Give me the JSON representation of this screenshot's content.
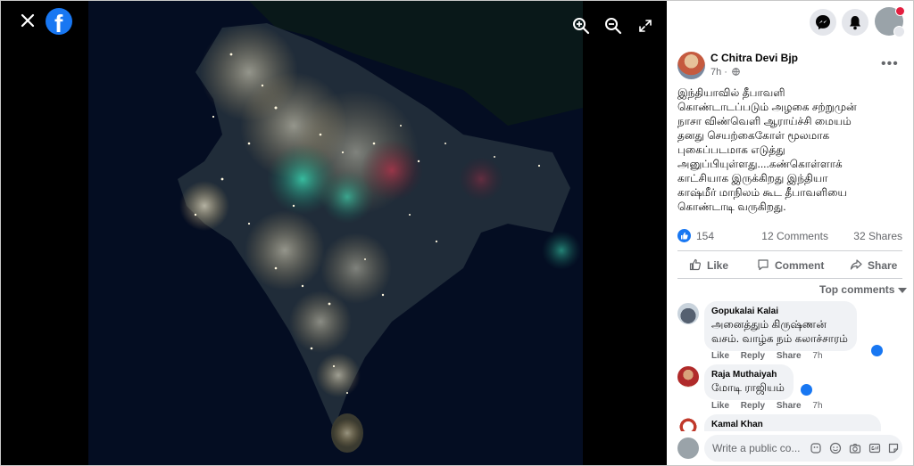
{
  "viewer": {
    "close_icon": "close-icon",
    "logo_icon": "facebook-logo-icon",
    "logo_letter": "f",
    "zoom_in_icon": "zoom-in-icon",
    "zoom_out_icon": "zoom-out-icon",
    "fullscreen_icon": "fullscreen-icon"
  },
  "topbar": {
    "messenger_icon": "messenger-icon",
    "notifications_icon": "bell-icon",
    "profile_icon": "account-avatar"
  },
  "post": {
    "author": "C Chitra Devi Bjp",
    "time": "7h ·",
    "privacy_icon": "globe-icon",
    "more_label": "•••",
    "text_lines": [
      "இந்தியாவில் தீபாவளி",
      "கொண்டாடப்படும் அழகை சற்றுமுன்",
      "நாசா விண்வெளி ஆராய்ச்சி மையம்",
      "தனது செயற்கைகோள் மூலமாக",
      "புகைப்படமாக எடுத்து",
      "அனுப்பியுள்ளது....கண்கொள்ளாக்",
      "காட்சியாக இருக்கிறது இந்தியா",
      "காஷ்மீர் மாநிலம் கூட தீபாவளியை",
      "கொண்டாடி வருகிறது."
    ],
    "likes": "154",
    "comments": "12 Comments",
    "shares": "32 Shares"
  },
  "actions": {
    "like": "Like",
    "comment": "Comment",
    "share": "Share"
  },
  "top_comments_label": "Top comments",
  "comments": [
    {
      "name": "Gopukalai Kalai",
      "lines": [
        "அனைத்தும் கிருஷ்ணன்",
        "வசம். வாழ்க நம் கலாச்சாரம்"
      ],
      "like": "Like",
      "reply": "Reply",
      "share": "Share",
      "time": "7h"
    },
    {
      "name": "Raja Muthaiyah",
      "lines": [
        "மோடி ராஜியம்"
      ],
      "like": "Like",
      "reply": "Reply",
      "share": "Share",
      "time": "7h"
    },
    {
      "name": "Kamal Khan",
      "lines": [],
      "like": "",
      "reply": "",
      "share": "",
      "time": ""
    }
  ],
  "comment_box": {
    "placeholder": "Write a public co..."
  },
  "colors": {
    "facebook_blue": "#1877f2",
    "secondary_text": "#65676b",
    "bubble_bg": "#f0f2f5"
  }
}
